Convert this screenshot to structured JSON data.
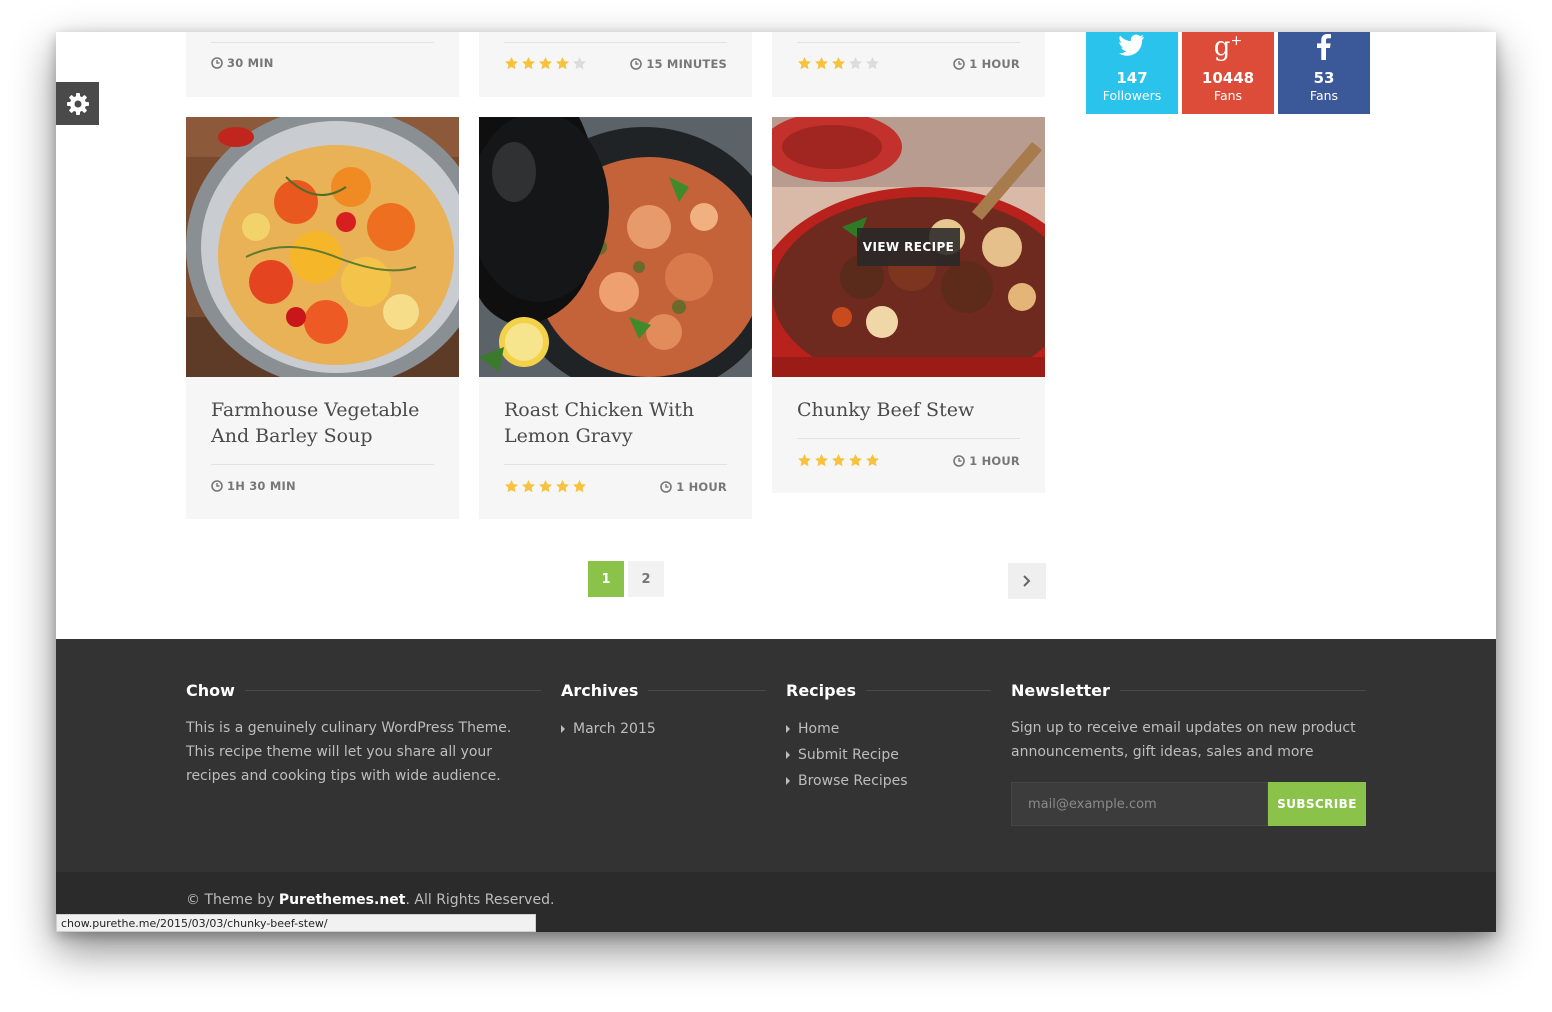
{
  "top_row": [
    {
      "time": "30 MIN",
      "rating": null
    },
    {
      "time": "15 MINUTES",
      "rating": 4
    },
    {
      "time": "1 HOUR",
      "rating": 3
    }
  ],
  "recipes": [
    {
      "title": "Farmhouse Vegetable And Barley Soup",
      "time": "1H 30 MIN",
      "rating": null
    },
    {
      "title": "Roast Chicken With Lemon Gravy",
      "time": "1 HOUR",
      "rating": 5
    },
    {
      "title": "Chunky Beef Stew",
      "time": "1 HOUR",
      "rating": 5,
      "overlay": "VIEW RECIPE"
    }
  ],
  "social": [
    {
      "network": "twitter-icon",
      "count": "147",
      "label": "Followers",
      "color": "#29c3ec"
    },
    {
      "network": "google-plus-icon",
      "count": "10448",
      "label": "Fans",
      "color": "#dd4b39"
    },
    {
      "network": "facebook-icon",
      "count": "53",
      "label": "Fans",
      "color": "#3b5998"
    }
  ],
  "pagination": {
    "pages": [
      "1",
      "2"
    ],
    "current": "1",
    "accent": "#8bc34a"
  },
  "footer": {
    "about": {
      "title": "Chow",
      "text": "This is a genuinely culinary WordPress Theme. This recipe theme will let you share all your recipes and cooking tips with wide audience."
    },
    "archives": {
      "title": "Archives",
      "items": [
        "March 2015"
      ]
    },
    "recipes": {
      "title": "Recipes",
      "items": [
        "Home",
        "Submit Recipe",
        "Browse Recipes"
      ]
    },
    "newsletter": {
      "title": "Newsletter",
      "text": "Sign up to receive email updates on new product announcements, gift ideas, sales and more",
      "placeholder": "mail@example.com",
      "button": "SUBSCRIBE"
    },
    "copyright_prefix": "© Theme by ",
    "copyright_brand": "Purethemes.net",
    "copyright_suffix": ". All Rights Reserved."
  },
  "status_url": "chow.purethe.me/2015/03/03/chunky-beef-stew/",
  "colors": {
    "star": "#f7c23e",
    "star_empty": "#dcdcdc",
    "accent": "#8bc34a"
  }
}
